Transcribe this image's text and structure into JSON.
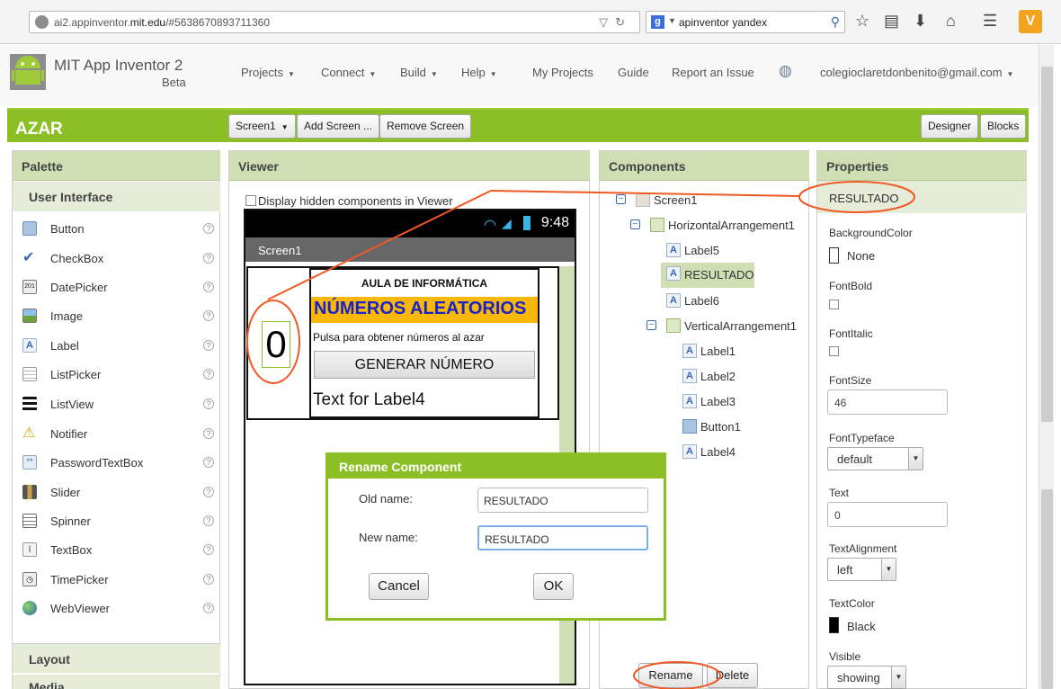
{
  "browser": {
    "url_prefix": "ai2.appinventor.",
    "url_domain": "mit.edu",
    "url_suffix": "/#5638670893711360",
    "search_engine_glyph": "g",
    "search_query": "apinventor yandex",
    "extension_glyph": "V"
  },
  "header": {
    "title": "MIT App Inventor 2",
    "beta": "Beta",
    "menus": [
      "Projects",
      "Connect",
      "Build",
      "Help"
    ],
    "links": [
      "My Projects",
      "Guide",
      "Report an Issue"
    ],
    "account": "colegioclaretdonbenito@gmail.com"
  },
  "project_bar": {
    "project_name": "AZAR",
    "screen_select": "Screen1",
    "add_screen": "Add Screen ...",
    "remove_screen": "Remove Screen",
    "designer": "Designer",
    "blocks": "Blocks"
  },
  "palette": {
    "title": "Palette",
    "section": "User Interface",
    "items": [
      "Button",
      "CheckBox",
      "DatePicker",
      "Image",
      "Label",
      "ListPicker",
      "ListView",
      "Notifier",
      "PasswordTextBox",
      "Slider",
      "Spinner",
      "TextBox",
      "TimePicker",
      "WebViewer"
    ],
    "help_glyph": "?",
    "layout": "Layout",
    "media": "Media"
  },
  "viewer": {
    "title": "Viewer",
    "display_hidden": "Display hidden components in Viewer",
    "status_time": "9:48",
    "screen_title": "Screen1",
    "result_value": "0",
    "label1": "AULA DE INFORMÁTICA",
    "label2": "NÚMEROS ALEATORIOS",
    "label3": "Pulsa para obtener números al azar",
    "button1": "GENERAR NÚMERO",
    "label4": "Text for Label4"
  },
  "dialog": {
    "title": "Rename Component",
    "old_name_label": "Old name:",
    "old_name_value": "RESULTADO",
    "new_name_label": "New name:",
    "new_name_value": "RESULTADO",
    "cancel": "Cancel",
    "ok": "OK"
  },
  "components": {
    "title": "Components",
    "tree": [
      "Screen1",
      "HorizontalArrangement1",
      "Label5",
      "RESULTADO",
      "Label6",
      "VerticalArrangement1",
      "Label1",
      "Label2",
      "Label3",
      "Button1",
      "Label4"
    ],
    "label_icon_glyph": "A",
    "rename": "Rename",
    "delete": "Delete"
  },
  "properties": {
    "title": "Properties",
    "component": "RESULTADO",
    "background_color_label": "BackgroundColor",
    "background_color_value": "None",
    "font_bold_label": "FontBold",
    "font_italic_label": "FontItalic",
    "font_size_label": "FontSize",
    "font_size_value": "46",
    "font_typeface_label": "FontTypeface",
    "font_typeface_value": "default",
    "text_label": "Text",
    "text_value": "0",
    "text_alignment_label": "TextAlignment",
    "text_alignment_value": "left",
    "text_color_label": "TextColor",
    "text_color_value": "Black",
    "visible_label": "Visible",
    "visible_value": "showing"
  },
  "colors": {
    "accent_green": "#8cbf26",
    "panel_head": "#cfdeb3",
    "annotation_red": "#ee5a24",
    "label2_bg": "#f9b807",
    "label2_text": "#1a22c9"
  }
}
